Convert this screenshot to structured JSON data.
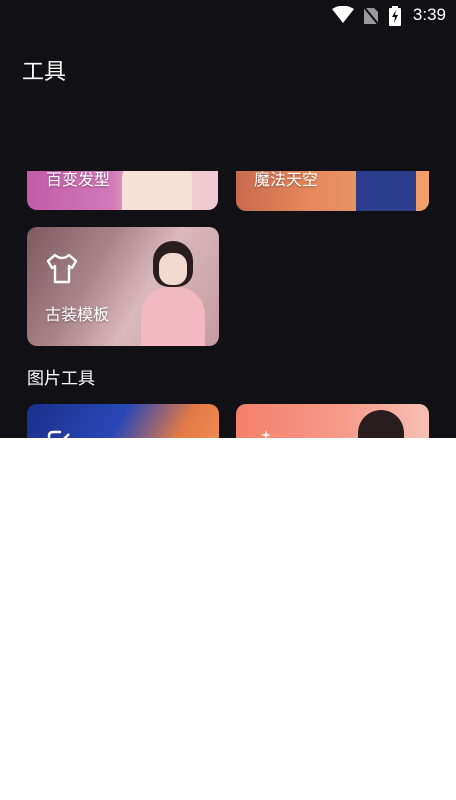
{
  "status_bar": {
    "time": "3:39",
    "icons": [
      "wifi-icon",
      "no-sim-icon",
      "battery-charging-icon"
    ]
  },
  "page": {
    "title": "工具"
  },
  "cards": {
    "hair": {
      "label": "百变发型"
    },
    "magic": {
      "label": "魔法天空"
    },
    "costume": {
      "label": "古装模板",
      "icon": "shirt-icon"
    }
  },
  "sections": {
    "photo_tools": "图片工具"
  },
  "photo_tools": {
    "edit": {
      "icon": "edit-icon"
    },
    "magic_wand": {
      "icon": "magic-wand-icon"
    }
  }
}
